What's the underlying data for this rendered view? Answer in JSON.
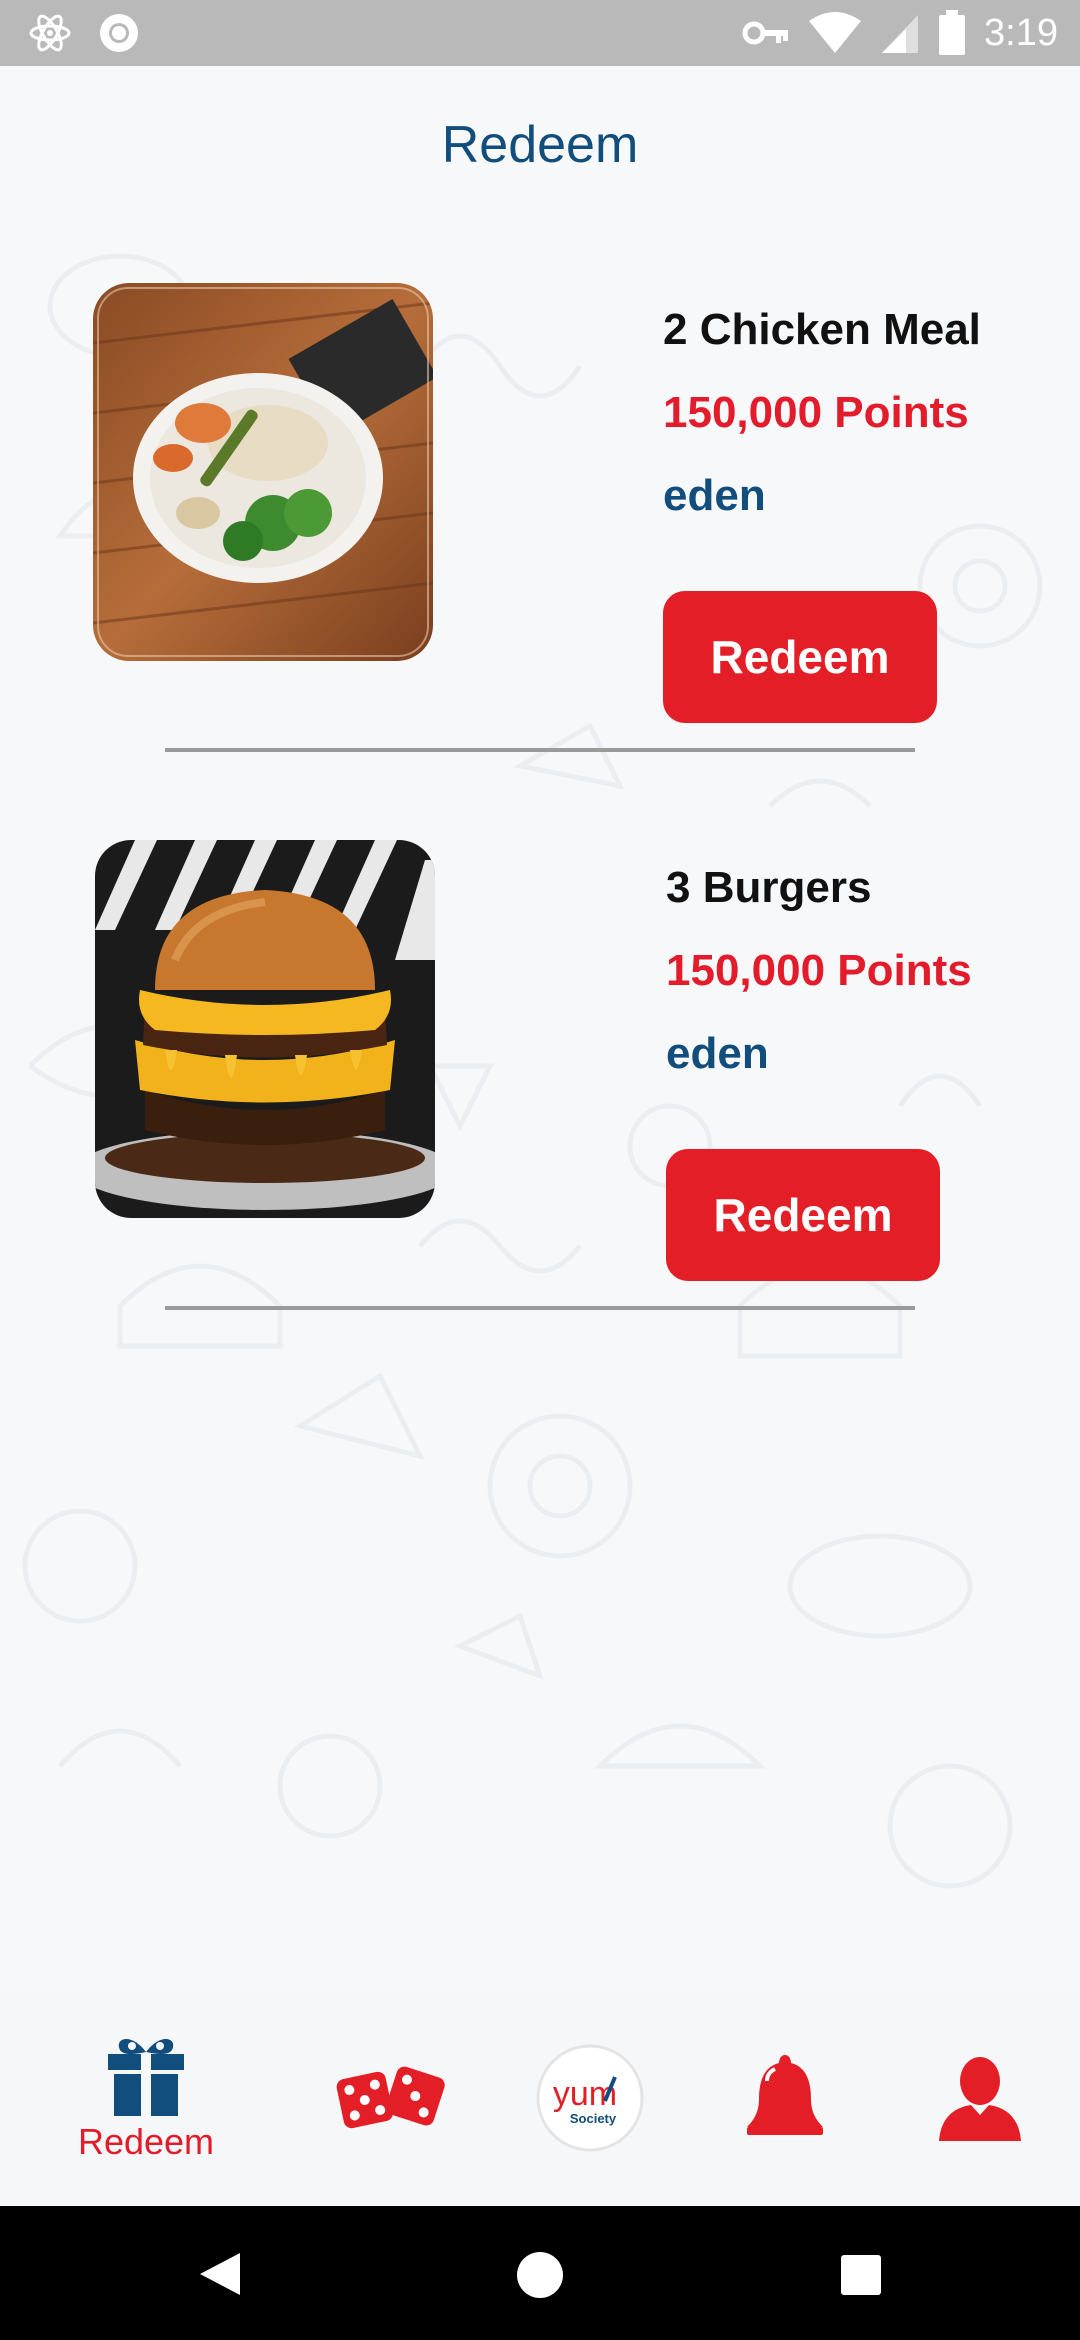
{
  "status_bar": {
    "time": "3:19"
  },
  "header": {
    "title": "Redeem"
  },
  "rewards": [
    {
      "title": "2 Chicken Meal",
      "points": "150,000 Points",
      "vendor": "eden",
      "button_label": "Redeem"
    },
    {
      "title": "3 Burgers",
      "points": "150,000 Points",
      "vendor": "eden",
      "button_label": "Redeem"
    }
  ],
  "bottom_nav": {
    "items": [
      {
        "icon": "gift-icon",
        "label": "Redeem",
        "active": true
      },
      {
        "icon": "dice-icon"
      },
      {
        "icon": "yum-society-logo",
        "logo_text_main": "yum",
        "logo_text_sub": "Society"
      },
      {
        "icon": "bell-icon"
      },
      {
        "icon": "profile-icon"
      }
    ]
  },
  "colors": {
    "brand_red": "#e41e27",
    "brand_blue": "#124e7d"
  }
}
